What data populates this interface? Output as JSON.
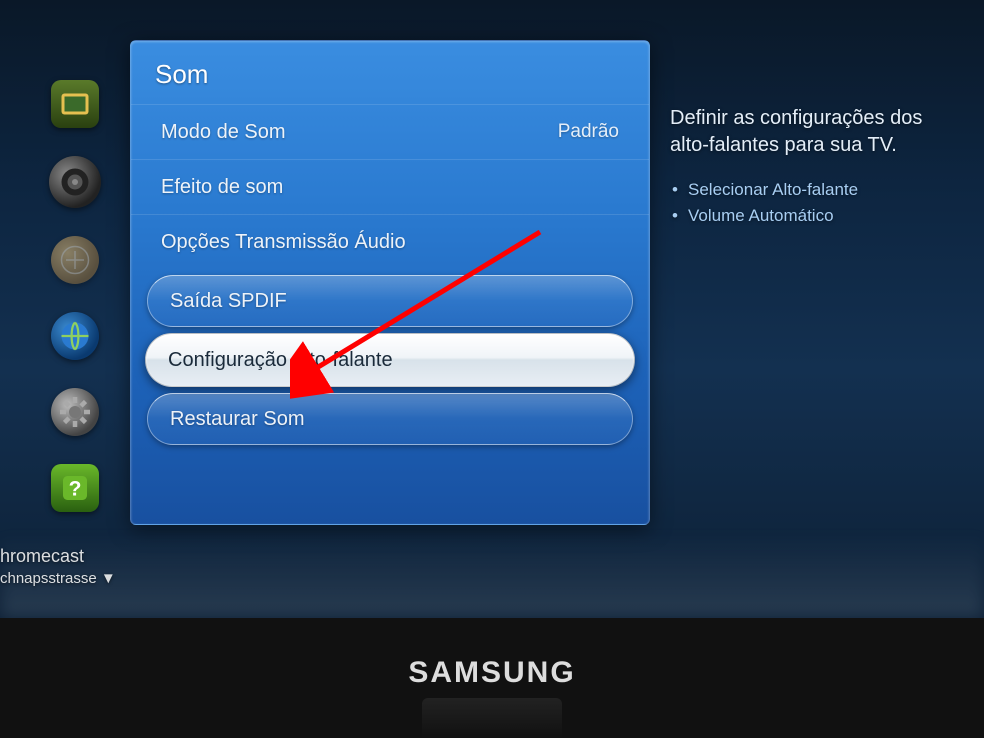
{
  "brand": "SAMSUNG",
  "panel": {
    "title": "Som",
    "items": [
      {
        "label": "Modo de Som",
        "value": "Padrão",
        "style": "plain"
      },
      {
        "label": "Efeito de som",
        "style": "plain"
      },
      {
        "label": "Opções Transmissão Áudio",
        "style": "plain"
      },
      {
        "label": "Saída SPDIF",
        "style": "glassy"
      },
      {
        "label": "Configuração Alto-falante",
        "style": "selected"
      },
      {
        "label": "Restaurar Som",
        "style": "glassy"
      }
    ]
  },
  "help": {
    "title": "Definir as configurações dos alto-falantes para sua TV.",
    "bullets": [
      "Selecionar Alto-falante",
      "Volume Automático"
    ]
  },
  "corner": {
    "line1": "hromecast",
    "line2": "chnapsstrasse ▼"
  },
  "rail_icons": [
    "picture-icon",
    "speaker-icon",
    "channel-icon",
    "network-icon",
    "settings-gear-icon",
    "support-icon"
  ]
}
